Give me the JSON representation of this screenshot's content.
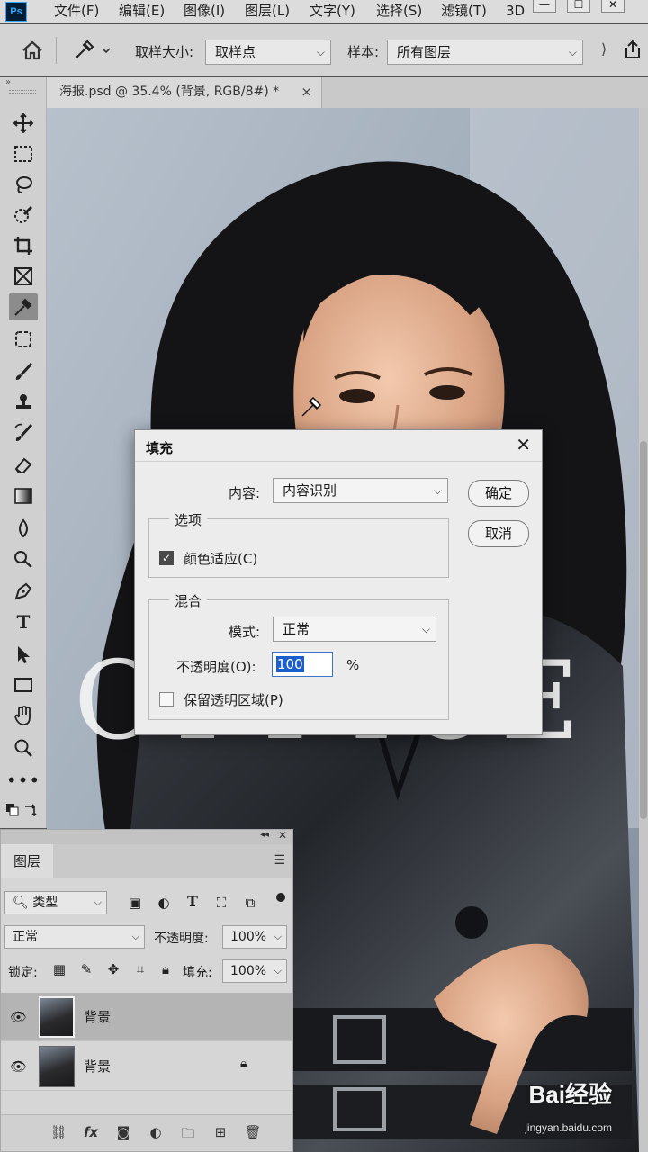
{
  "app": {
    "logo": "Ps",
    "menu": [
      "文件(F)",
      "编辑(E)",
      "图像(I)",
      "图层(L)",
      "文字(Y)",
      "选择(S)",
      "滤镜(T)",
      "3D"
    ]
  },
  "options_bar": {
    "sample_size_label": "取样大小:",
    "sample_size_value": "取样点",
    "sample_label": "样本:",
    "sample_value": "所有图层"
  },
  "document": {
    "tab_title": "海报.psd @ 35.4% (背景, RGB/8#) *",
    "tab_close": "×"
  },
  "tools": [
    "move-tool",
    "marquee-tool",
    "lasso-tool",
    "quick-select-tool",
    "crop-tool",
    "frame-tool",
    "eyedropper-tool",
    "patch-tool",
    "brush-tool",
    "stamp-tool",
    "history-brush-tool",
    "eraser-tool",
    "gradient-tool",
    "blur-tool",
    "dodge-tool",
    "pen-tool",
    "type-tool",
    "path-select-tool",
    "rectangle-tool",
    "hand-tool",
    "zoom-tool",
    "more-tools"
  ],
  "fill_dialog": {
    "title": "填充",
    "close": "✕",
    "content_label": "内容:",
    "content_value": "内容识别",
    "ok_label": "确定",
    "cancel_label": "取消",
    "options_group": "选项",
    "color_adapt_label": "颜色适应(C)",
    "color_adapt_checked": true,
    "blend_group": "混合",
    "mode_label": "模式:",
    "mode_value": "正常",
    "opacity_label": "不透明度(O):",
    "opacity_value": "100",
    "opacity_unit": "%",
    "preserve_label": "保留透明区域(P)",
    "preserve_checked": false
  },
  "layers_panel": {
    "tab": "图层",
    "filter_value": "类型",
    "blend_mode": "正常",
    "opacity_label": "不透明度:",
    "opacity_value": "100%",
    "lock_label": "锁定:",
    "fill_label": "填充:",
    "fill_value": "100%",
    "layers": [
      {
        "name": "背景",
        "selected": true,
        "locked": false
      },
      {
        "name": "背景",
        "selected": false,
        "locked": true
      }
    ]
  },
  "watermark": {
    "brand": "Bai经验",
    "url": "jingyan.baidu.com"
  },
  "colors": {
    "selection_highlight": "#1b5fcf",
    "panel_bg": "#d6d6d6"
  }
}
